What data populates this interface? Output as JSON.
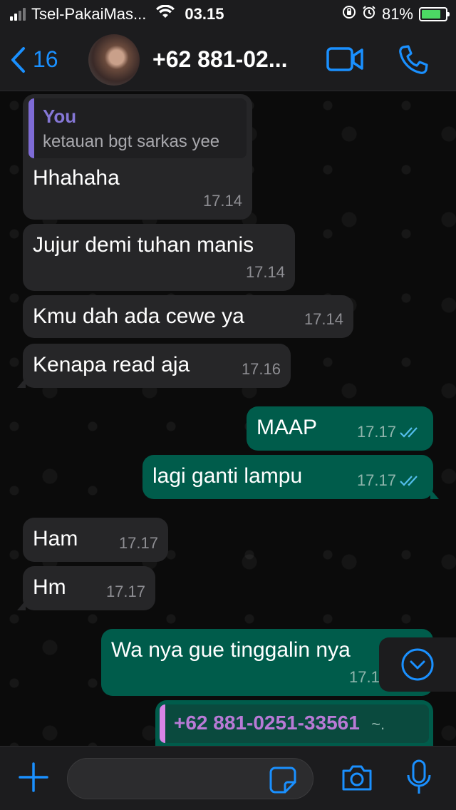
{
  "status_bar": {
    "carrier": "Tsel-PakaiMas...",
    "time": "03.15",
    "battery": "81%",
    "battery_level": 0.81
  },
  "header": {
    "back_count": "16",
    "contact_name": "+62 881-02...",
    "icons": [
      "chevron-left-icon",
      "video-call-icon",
      "phone-icon"
    ]
  },
  "messages": [
    {
      "dir": "in",
      "quote_name": "You",
      "quote_text": "ketauan bgt sarkas yee",
      "text": "Hhahaha",
      "time": "17.14"
    },
    {
      "dir": "in",
      "text": "Jujur demi tuhan manis",
      "time": "17.14"
    },
    {
      "dir": "in",
      "text": "Kmu dah ada cewe ya",
      "time": "17.14"
    },
    {
      "dir": "in",
      "text": "Kenapa read aja",
      "time": "17.16"
    },
    {
      "dir": "out",
      "text": "MAAP",
      "time": "17.17",
      "status": "read"
    },
    {
      "dir": "out",
      "text": "lagi ganti lampu",
      "time": "17.17",
      "status": "read"
    },
    {
      "dir": "in",
      "text": "Ham",
      "time": "17.17"
    },
    {
      "dir": "in",
      "text": "Hm",
      "time": "17.17"
    },
    {
      "dir": "out",
      "text": "Wa nya gue tinggalin nya",
      "time": "17.1"
    },
    {
      "dir": "out",
      "quote_name": "+62 881-0251-33561",
      "quote_suffix": "~."
    }
  ],
  "input_bar": {
    "icons": [
      "plus-icon",
      "sticker-icon",
      "camera-icon",
      "microphone-icon"
    ]
  },
  "colors": {
    "accent": "#1a90ff",
    "incoming_bubble": "#262628",
    "outgoing_bubble": "#005c4b",
    "read_ticks": "#53bdeb"
  }
}
